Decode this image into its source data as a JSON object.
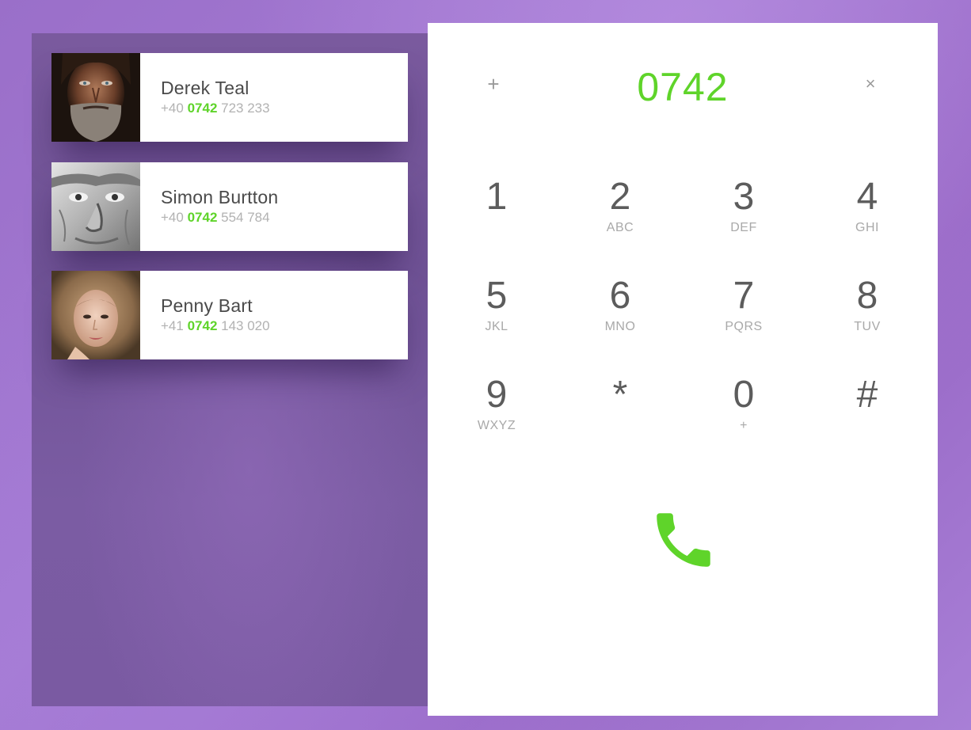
{
  "contacts": [
    {
      "name": "Derek Teal",
      "number_prefix": "+40",
      "number_match": "0742",
      "number_rest": "723 233"
    },
    {
      "name": "Simon Burtton",
      "number_prefix": "+40",
      "number_match": "0742",
      "number_rest": "554 784"
    },
    {
      "name": "Penny Bart",
      "number_prefix": "+41",
      "number_match": "0742",
      "number_rest": "143 020"
    }
  ],
  "dialer": {
    "add_label": "+",
    "display_value": "0742",
    "clear_label": "×",
    "keys": [
      {
        "digit": "1",
        "letters": ""
      },
      {
        "digit": "2",
        "letters": "ABC"
      },
      {
        "digit": "3",
        "letters": "DEF"
      },
      {
        "digit": "4",
        "letters": "GHI"
      },
      {
        "digit": "5",
        "letters": "JKL"
      },
      {
        "digit": "6",
        "letters": "MNO"
      },
      {
        "digit": "7",
        "letters": "PQRS"
      },
      {
        "digit": "8",
        "letters": "TUV"
      },
      {
        "digit": "9",
        "letters": "WXYZ"
      },
      {
        "digit": "*",
        "letters": ""
      },
      {
        "digit": "0",
        "letters": "+"
      },
      {
        "digit": "#",
        "letters": ""
      }
    ],
    "call_icon": "phone-icon"
  },
  "colors": {
    "accent_green": "#5fd42a",
    "background_purple": "#a47ad3",
    "panel_purple": "#7358a0",
    "key_text": "#5c5c5c",
    "muted_text": "#a9a9a9"
  }
}
